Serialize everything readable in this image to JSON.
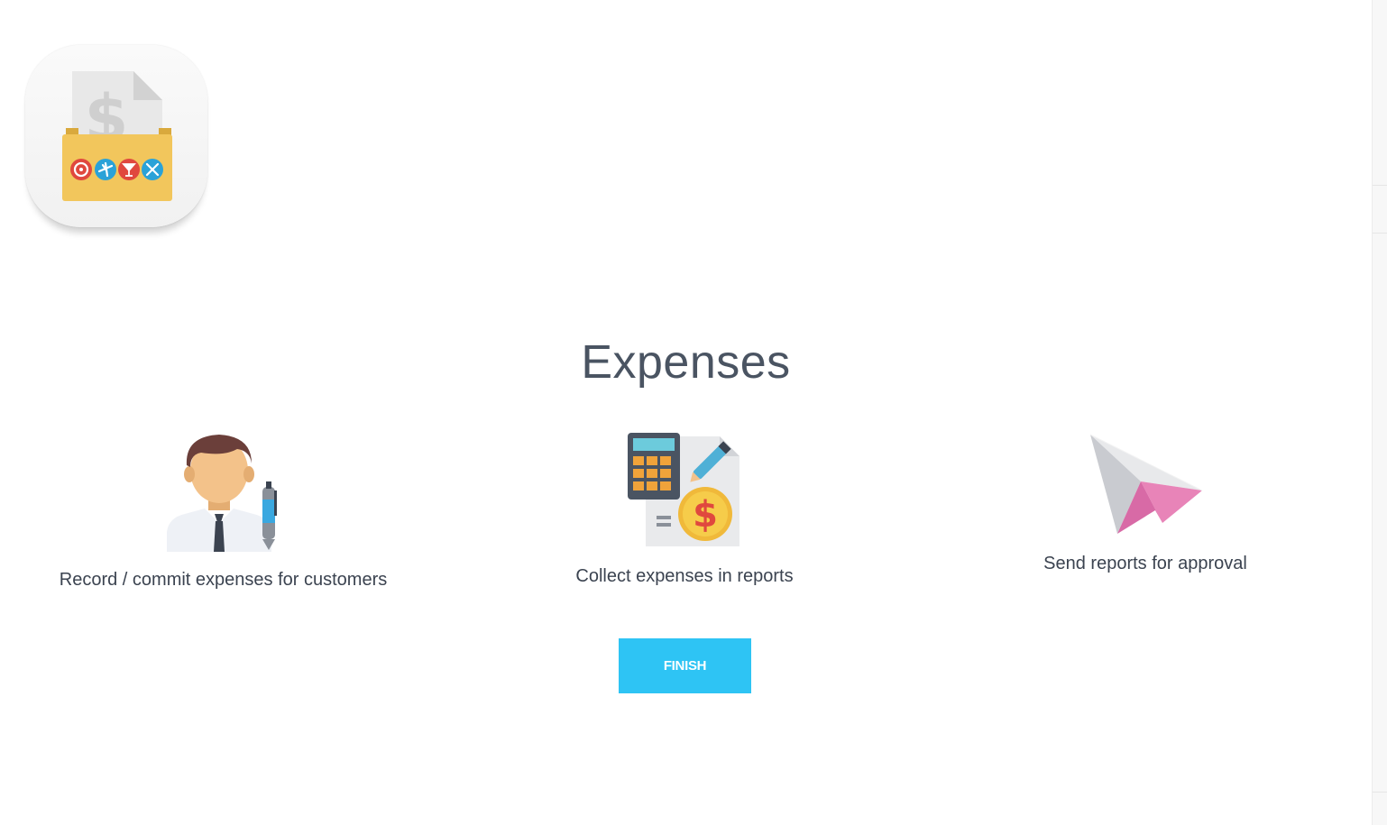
{
  "app": {
    "icon_name": "expenses-app-icon"
  },
  "main": {
    "title": "Expenses",
    "features": [
      {
        "label": "Record / commit expenses for customers",
        "icon": "employee-with-pen-icon"
      },
      {
        "label": "Collect expenses in reports",
        "icon": "calculator-invoice-icon"
      },
      {
        "label": "Send reports for approval",
        "icon": "paper-plane-icon"
      }
    ],
    "finish_label": "FINISH"
  },
  "colors": {
    "title": "#4a5462",
    "label": "#3b4350",
    "button": "#2ec4f4",
    "folder": "#f2c65c"
  }
}
